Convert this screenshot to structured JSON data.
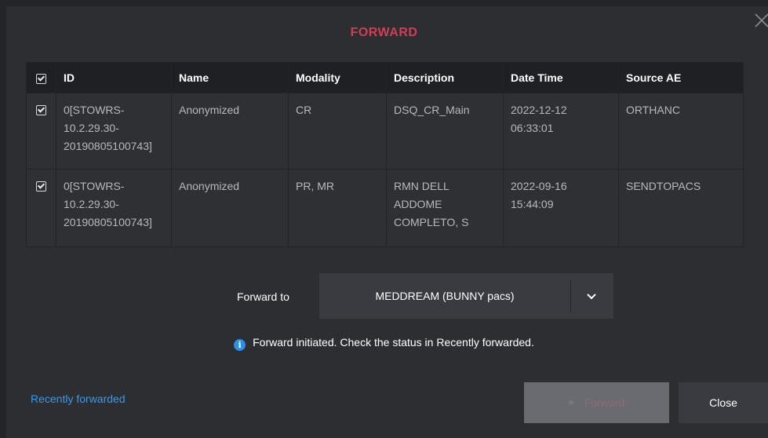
{
  "dialog": {
    "title": "FORWARD",
    "close_icon": "close-icon"
  },
  "table": {
    "header_checkbox_checked": true,
    "columns": [
      "ID",
      "Name",
      "Modality",
      "Description",
      "Date Time",
      "Source AE"
    ],
    "rows": [
      {
        "checked": true,
        "id": "0[STOWRS-\n10.2.29.30-\n20190805100743]",
        "name": "Anonymized",
        "modality": "CR",
        "description": "DSQ_CR_Main",
        "datetime": "2022-12-12\n06:33:01",
        "source_ae": "ORTHANC"
      },
      {
        "checked": true,
        "id": "0[STOWRS-\n10.2.29.30-\n20190805100743]",
        "name": "Anonymized",
        "modality": "PR, MR",
        "description": "RMN DELL\nADDOME\nCOMPLETO, S",
        "datetime": "2022-09-16\n15:44:09",
        "source_ae": "SENDTOPACS"
      }
    ]
  },
  "forward": {
    "label": "Forward to",
    "selected": "MEDDREAM (BUNNY pacs)",
    "dropdown_icon": "chevron-down-icon"
  },
  "info": {
    "icon": "info-icon",
    "message": "Forward initiated. Check the status in Recently forwarded."
  },
  "footer": {
    "recently_forwarded": "Recently forwarded",
    "forward_button": "Forward",
    "close_button": "Close"
  },
  "colors": {
    "title": "#d23d53",
    "link": "#3b9ae8",
    "info": "#2a8fe8",
    "background": "#2d2e31"
  }
}
